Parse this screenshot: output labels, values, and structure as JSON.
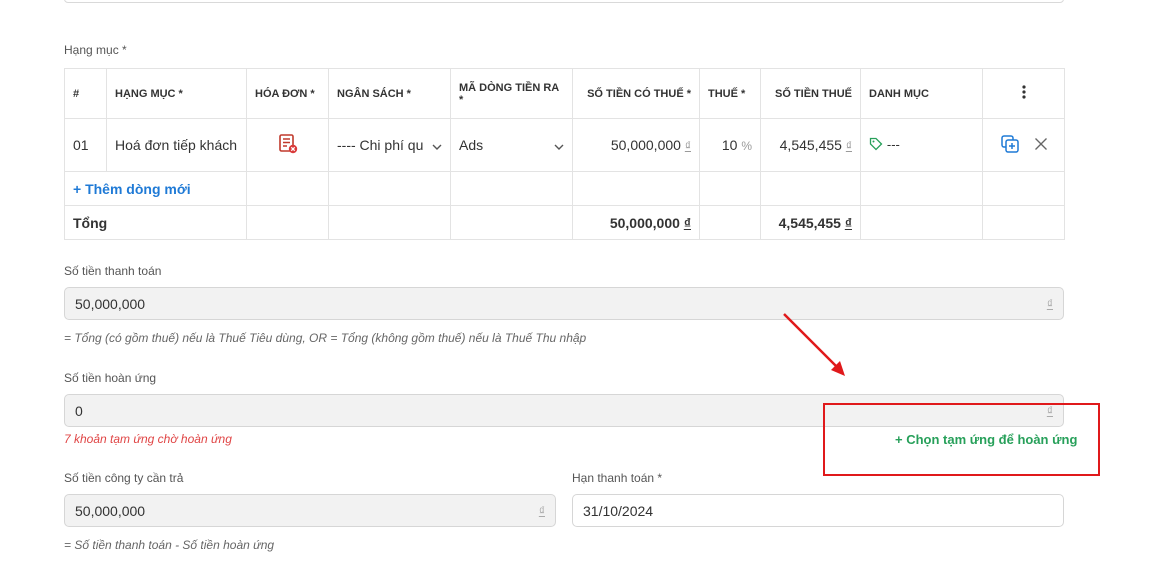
{
  "section_label": "Hạng mục *",
  "table": {
    "headers": [
      "#",
      "HẠNG MỤC *",
      "HÓA ĐƠN *",
      "NGÂN SÁCH *",
      "MÃ DÒNG TIỀN RA *",
      "SỐ TIỀN CÓ THUẾ *",
      "THUẾ *",
      "SỐ TIỀN THUẾ",
      "DANH MỤC"
    ],
    "row": {
      "index": "01",
      "item": "Hoá đơn tiếp khách",
      "budget": "---- Chi phí qu",
      "cashflow_code": "Ads",
      "amount_with_tax": "50,000,000",
      "currency": "₫",
      "tax": "10",
      "tax_unit": "%",
      "tax_amount": "4,545,455",
      "category": "---"
    },
    "add_row_label": "+ Thêm dòng mới",
    "total_label": "Tổng",
    "total_amount": "50,000,000",
    "total_tax": "4,545,455",
    "total_currency": "₫"
  },
  "payment_amount": {
    "label": "Số tiền thanh toán",
    "value": "50,000,000",
    "currency": "₫",
    "hint": "= Tổng (có gồm thuế) nếu là Thuế Tiêu dùng, OR = Tổng (không gồm thuế) nếu là Thuế Thu nhập"
  },
  "refund_amount": {
    "label": "Số tiền hoàn ứng",
    "value": "0",
    "currency": "₫",
    "warning": "7 khoản tạm ứng chờ hoàn ứng",
    "choose_link": "+ Chọn tạm ứng để hoàn ứng"
  },
  "company_pay": {
    "label": "Số tiền công ty cần trả",
    "value": "50,000,000",
    "currency": "₫",
    "hint": "= Số tiền thanh toán - Số tiền hoàn ứng"
  },
  "due_date": {
    "label": "Hạn thanh toán *",
    "value": "31/10/2024"
  },
  "colors": {
    "accent_blue": "#1f7ad6",
    "accent_green": "#27a05a",
    "warning_red": "#e04545",
    "annotation_red": "#e0191b"
  },
  "icons": [
    "invoice-error-icon",
    "chevron-down-icon",
    "tag-icon",
    "more-vertical-icon",
    "duplicate-icon",
    "close-icon",
    "annotation-arrow"
  ]
}
